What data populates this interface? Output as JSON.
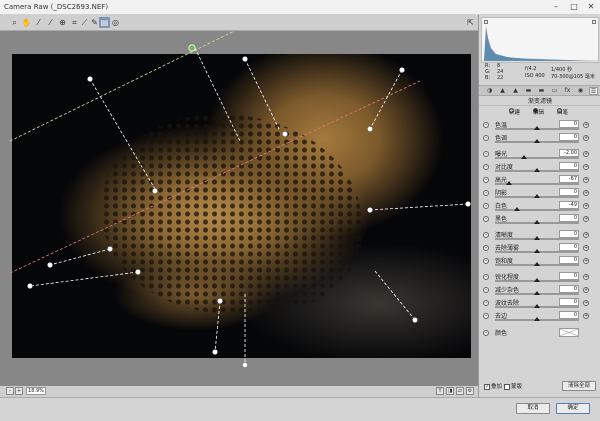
{
  "window": {
    "title": "Camera Raw (_DSC2693.NEF)"
  },
  "toolbar": {
    "tools": [
      "zoom-tool",
      "hand-tool",
      "white-balance-tool",
      "color-sampler-tool",
      "targeted-adjustment-tool",
      "crop-tool",
      "straighten-tool",
      "spot-removal-tool",
      "red-eye-tool",
      "adjustment-brush-tool",
      "graduated-filter-tool",
      "radial-filter-tool"
    ],
    "selected_tool": "graduated-filter-tool"
  },
  "histogram": {
    "meta": {
      "r_label": "R:",
      "g_label": "G:",
      "b_label": "B:",
      "r_value": "8",
      "g_value": "24",
      "b_value": "22",
      "aperture": "f/4.2",
      "shutter": "1/400 秒",
      "iso": "ISO 400",
      "lens": "70-300@105 毫米"
    }
  },
  "panel": {
    "title": "渐变滤镜",
    "modes": [
      {
        "label": "新建",
        "selected": false
      },
      {
        "label": "编辑",
        "selected": true
      },
      {
        "label": "画笔",
        "selected": false
      }
    ],
    "sliders": [
      {
        "label": "色温",
        "value": "0",
        "pos": 0.5
      },
      {
        "label": "色调",
        "value": "0",
        "pos": 0.5
      },
      {
        "label": "曝光",
        "value": "-2.00",
        "pos": 0.34
      },
      {
        "label": "对比度",
        "value": "0",
        "pos": 0.5
      },
      {
        "label": "高光",
        "value": "-67",
        "pos": 0.17
      },
      {
        "label": "阴影",
        "value": "0",
        "pos": 0.5
      },
      {
        "label": "白色",
        "value": "-49",
        "pos": 0.26
      },
      {
        "label": "黑色",
        "value": "0",
        "pos": 0.5
      },
      {
        "label": "清晰度",
        "value": "0",
        "pos": 0.5
      },
      {
        "label": "去除薄雾",
        "value": "0",
        "pos": 0.5
      },
      {
        "label": "饱和度",
        "value": "0",
        "pos": 0.5
      },
      {
        "label": "锐化程度",
        "value": "0",
        "pos": 0.5
      },
      {
        "label": "减少杂色",
        "value": "0",
        "pos": 0.5
      },
      {
        "label": "波纹去除",
        "value": "0",
        "pos": 0.5
      },
      {
        "label": "去边",
        "value": "0",
        "pos": 0.5
      }
    ],
    "color_label": "颜色",
    "overlay_label": "叠加",
    "mask_label": "蒙版",
    "clear_all_label": "清除全部"
  },
  "status": {
    "zoom": "18.9%"
  },
  "footer": {
    "cancel_label": "取消",
    "ok_label": "确定"
  }
}
